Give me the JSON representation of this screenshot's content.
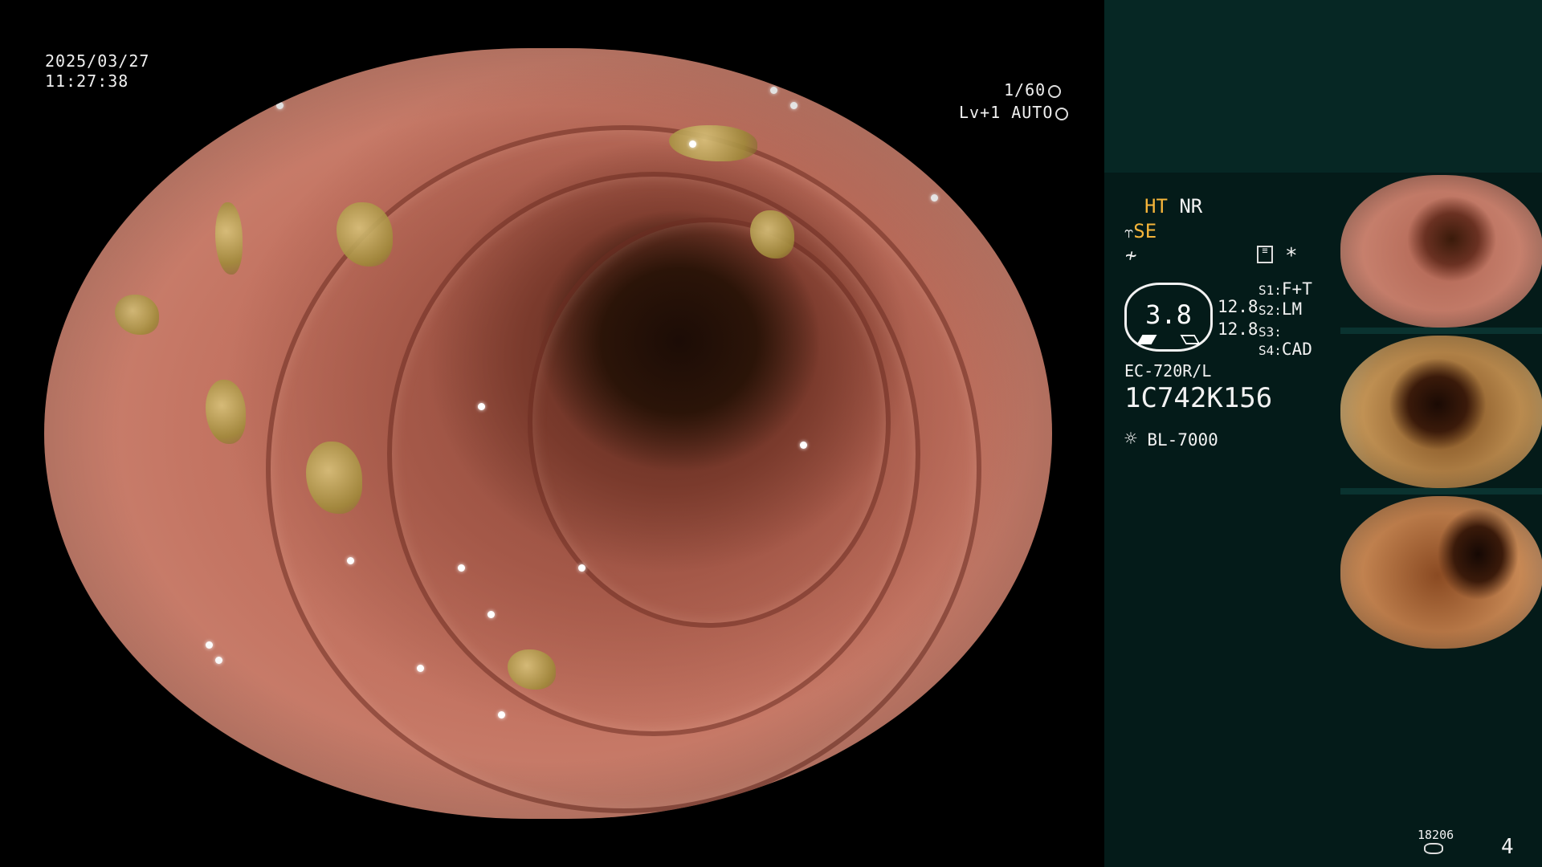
{
  "overlay": {
    "date": "2025/03/27",
    "time": "11:27:38",
    "shutter": "1/60",
    "level": "Lv+1 AUTO"
  },
  "panel": {
    "ht": "HT",
    "nr": "NR",
    "se": "SE",
    "gauge_value": "3.8",
    "val_top": "12.8",
    "val_bottom": "12.8",
    "s1_label": "S1:",
    "s1_value": "F+T",
    "s2_label": "S2:",
    "s2_value": "LM",
    "s3_label": "S3:",
    "s3_value": "",
    "s4_label": "S4:",
    "s4_value": "CAD",
    "scope_model": "EC-720R/L",
    "scope_serial": "1C742K156",
    "light_source": "BL-7000",
    "counter": "18206",
    "page_number": "4"
  },
  "icons": {
    "shutter": "aperture-icon",
    "level": "iris-icon",
    "scope": "scope-icon",
    "freeze": "freeze-icon",
    "memo": "memo-icon",
    "star": "asterisk-icon",
    "light": "lamp-icon",
    "disk": "disk-icon"
  },
  "colors": {
    "highlight": "#f6b53a",
    "panel_top": "#062724",
    "panel_bottom": "#041b19"
  }
}
